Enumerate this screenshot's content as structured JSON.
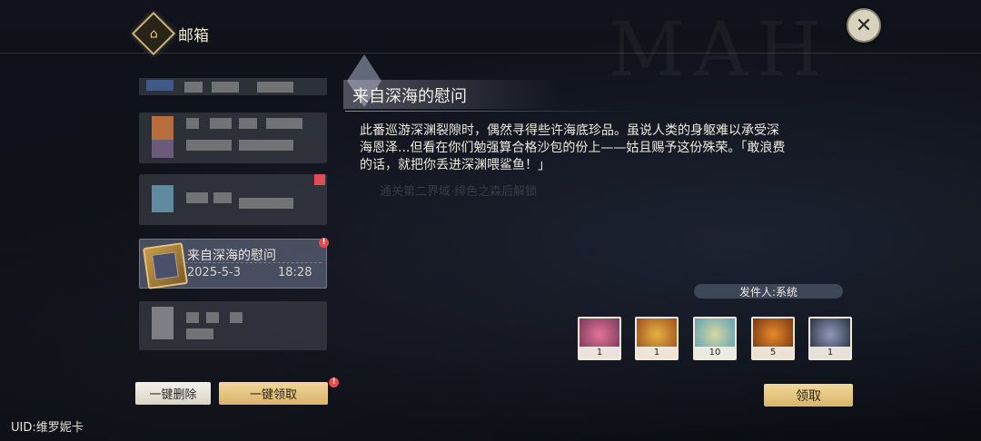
{
  "header": {
    "title": "邮箱",
    "emblem_icon": "mail-emblem-icon"
  },
  "close_icon_glyph": "✕",
  "watermark_text": "MAH",
  "mail_list": {
    "selected": {
      "title": "来自深海的慰问",
      "date": "2025-5-3",
      "time": "18:28"
    },
    "partial_top_text": "Tod..."
  },
  "buttons": {
    "delete_all": "一键删除",
    "claim_all": "一键领取",
    "claim": "领取"
  },
  "alert_glyph": "!",
  "uid_label": "UID:维罗妮卡",
  "detail": {
    "title": "来自深海的慰问",
    "body": "此番巡游深渊裂隙时，偶然寻得些许海底珍品。虽说人类的身躯难以承受深\n海恩泽...但看在你们勉强算合格沙包的份上——姑且赐予这份殊荣。「敢浪费\n的话，就把你丢进深渊喂鲨鱼！」",
    "faint_note": "通关第二界域·绯色之森后解锁",
    "sender": "发件人:系统"
  },
  "attachments": [
    {
      "name": "card-ticket",
      "count": "1",
      "colors": [
        "#e2739a",
        "#7b3a5a"
      ]
    },
    {
      "name": "gold-fist-badge",
      "count": "1",
      "colors": [
        "#e7b341",
        "#a0501f"
      ]
    },
    {
      "name": "crystal-coin",
      "count": "10",
      "colors": [
        "#d9d7a0",
        "#5fa2b8"
      ]
    },
    {
      "name": "orange-fruit-pile",
      "count": "5",
      "colors": [
        "#e88a2a",
        "#7a3812"
      ]
    },
    {
      "name": "armor-chest",
      "count": "1",
      "colors": [
        "#8f9bb8",
        "#2c3346"
      ]
    }
  ]
}
